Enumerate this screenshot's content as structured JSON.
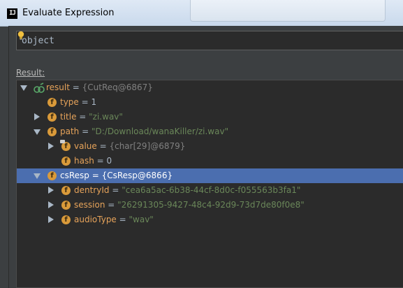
{
  "window": {
    "title": "Evaluate Expression",
    "app_icon": "IJ"
  },
  "expression": {
    "value": "object"
  },
  "result_label": "Result:",
  "tree": [
    {
      "name": "result",
      "value": "{CutReq@6867}",
      "kind": "ref"
    },
    {
      "name": "type",
      "value": "1",
      "kind": "num"
    },
    {
      "name": "title",
      "value": "\"zi.wav\"",
      "kind": "str"
    },
    {
      "name": "path",
      "value": "\"D:/Download/wanaKiller/zi.wav\"",
      "kind": "str"
    },
    {
      "name": "value",
      "value": "{char[29]@6879}",
      "kind": "ref"
    },
    {
      "name": "hash",
      "value": "0",
      "kind": "num"
    },
    {
      "name": "csResp",
      "value": "{CsResp@6866}",
      "kind": "ref"
    },
    {
      "name": "dentryId",
      "value": "\"cea6a5ac-6b38-44cf-8d0c-f055563b3fa1\"",
      "kind": "str"
    },
    {
      "name": "session",
      "value": "\"26291305-9427-48c4-92d9-73d7de80f0e8\"",
      "kind": "str"
    },
    {
      "name": "audioType",
      "value": "\"wav\"",
      "kind": "str"
    }
  ],
  "colors": {
    "selection": "#4b6eaf",
    "field_icon": "#d99a3a",
    "string": "#6a8759",
    "reference": "#808080"
  }
}
